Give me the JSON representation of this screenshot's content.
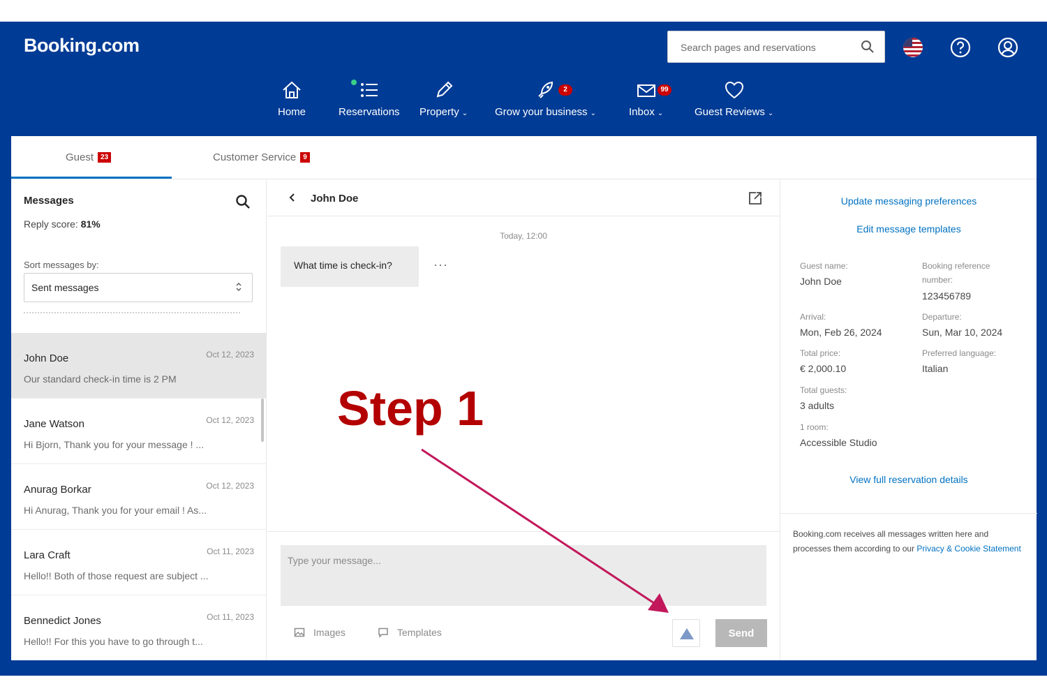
{
  "brand": {
    "logo": "Booking.com",
    "frame_color": "#003b95",
    "accent": "#0071c2",
    "badge_color": "#cc0000"
  },
  "header": {
    "search_placeholder": "Search pages and reservations",
    "icons": [
      "search-icon",
      "us-flag-icon",
      "help-icon",
      "account-icon"
    ]
  },
  "nav": [
    {
      "label": "Home",
      "icon": "home-icon"
    },
    {
      "label": "Reservations",
      "icon": "reservations-icon"
    },
    {
      "label": "Property",
      "icon": "pencil-icon",
      "dropdown": true
    },
    {
      "label": "Grow your business",
      "icon": "rocket-icon",
      "badge": "2",
      "dropdown": true
    },
    {
      "label": "Inbox",
      "icon": "envelope-icon",
      "badge": "99",
      "dropdown": true
    },
    {
      "label": "Guest Reviews",
      "icon": "heart-icon",
      "dropdown": true
    }
  ],
  "tabs": [
    {
      "label": "Guest",
      "badge": "23"
    },
    {
      "label": "Customer Service",
      "badge": "9"
    }
  ],
  "messages_panel": {
    "title": "Messages",
    "reply_score_label": "Reply score:",
    "reply_score_value": "81%",
    "sort_label": "Sort messages by:",
    "sort_value": "Sent messages"
  },
  "conversations": [
    {
      "name": "John Doe",
      "date": "Oct 12, 2023",
      "preview": "Our standard check-in time is 2 PM"
    },
    {
      "name": "Jane Watson",
      "date": "Oct 12, 2023",
      "preview": "Hi Bjorn, Thank you for your message ! ..."
    },
    {
      "name": "Anurag Borkar",
      "date": "Oct 12, 2023",
      "preview": "Hi Anurag, Thank you for your email ! As..."
    },
    {
      "name": "Lara Craft",
      "date": "Oct 11, 2023",
      "preview": "Hello!! Both of those request are subject ..."
    },
    {
      "name": "Bennedict Jones",
      "date": "Oct 11, 2023",
      "preview": "Hello!! For this you have to go through t..."
    }
  ],
  "chat": {
    "contact": "John Doe",
    "timestamp": "Today, 12:00",
    "message": "What time is check-in?",
    "more": "···",
    "composer_placeholder": "Type your message...",
    "images_label": "Images",
    "templates_label": "Templates",
    "send_label": "Send"
  },
  "annotation": {
    "text": "Step 1",
    "color": "#b30000",
    "arrow_color": "#c2185b"
  },
  "details": {
    "update_prefs_link": "Update messaging preferences",
    "edit_templates_link": "Edit message templates",
    "guest_name_label": "Guest name:",
    "guest_name": "John Doe",
    "booking_ref_label_1": "Booking reference",
    "booking_ref_label_2": "number:",
    "booking_ref": "123456789",
    "arrival_label": "Arrival:",
    "arrival": "Mon, Feb 26, 2024",
    "departure_label": "Departure:",
    "departure": "Sun, Mar 10, 2024",
    "total_price_label": "Total price:",
    "total_price": "€ 2,000.10",
    "language_label": "Preferred language:",
    "language": "Italian",
    "total_guests_label": "Total guests:",
    "total_guests": "3 adults",
    "rooms_label": "1 room:",
    "room": "Accessible Studio",
    "view_details_link": "View full reservation details",
    "privacy_text": "Booking.com receives all messages written here and processes them according to our ",
    "privacy_link": "Privacy & Cookie Statement"
  }
}
